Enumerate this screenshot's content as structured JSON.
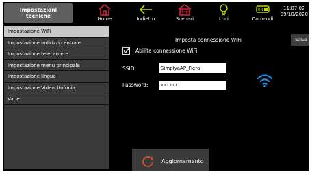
{
  "header": {
    "title_line1": "Impostazioni",
    "title_line2": "tecniche",
    "nav": [
      {
        "label": "Home",
        "icon": "home-icon",
        "color": "#e0203b"
      },
      {
        "label": "Indietro",
        "icon": "back-arrow-icon",
        "color": "#c4d600"
      },
      {
        "label": "Scenari",
        "icon": "scenarios-icon",
        "color": "#e0203b"
      },
      {
        "label": "Luci",
        "icon": "light-bulb-icon",
        "color": "#c4d600"
      },
      {
        "label": "Comandi",
        "icon": "toggle-on-icon",
        "color": "#c4d600"
      }
    ],
    "toggle_text": "ON",
    "time": "11:07:02",
    "date": "09/10/2020"
  },
  "sidebar": {
    "items": [
      {
        "label": "Impostazione WiFi",
        "active": true
      },
      {
        "label": "Impostazione indirizzi centrale"
      },
      {
        "label": "Impostazione telecamere"
      },
      {
        "label": "Impostazione menu principale"
      },
      {
        "label": "Impostazione lingua"
      },
      {
        "label": "Impostazione Videocitofonia"
      },
      {
        "label": "Varie"
      }
    ]
  },
  "main": {
    "title": "Imposta connessione WiFi",
    "save_label": "Salva",
    "enable_label": "Abilita connessione WiFi",
    "enable_checked": true,
    "ssid_label": "SSID:",
    "ssid_value": "SimplyaAP_Fiera",
    "password_label": "Password:",
    "password_value": "••••••",
    "update_label": "Aggiornamento",
    "wifi_color": "#1a8fe8",
    "refresh_color": "#e8542c"
  }
}
